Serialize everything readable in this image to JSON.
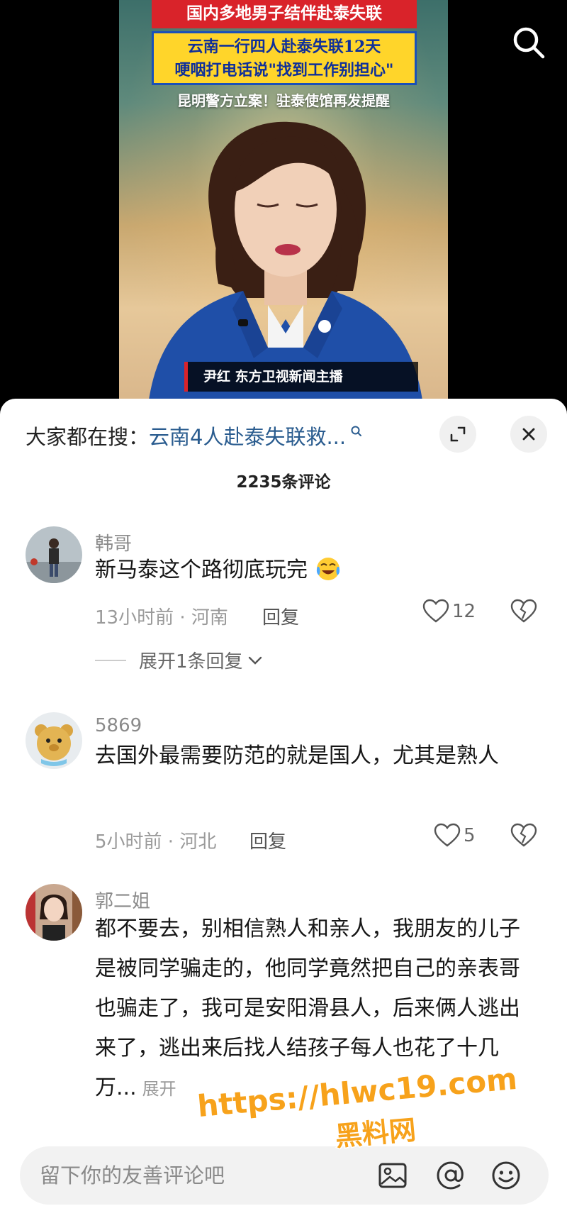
{
  "video": {
    "banner_top": "国内多地男子结伴赴泰失联",
    "banner_line1": "云南一行四人赴泰失联12天",
    "banner_line2": "哽咽打电话说\"找到工作别担心\"",
    "banner_sub": "昆明警方立案！驻泰使馆再发提醒",
    "anchor_caption": "尹红  东方卫视新闻主播"
  },
  "panel": {
    "hot_search_label": "大家都在搜：",
    "hot_search_keyword": "云南4人赴泰失联救...",
    "comment_count": "2235条评论"
  },
  "comments": [
    {
      "user": "韩哥",
      "text": "新马泰这个路彻底玩完",
      "time_location": "13小时前 · 河南",
      "reply_label": "回复",
      "likes": "12",
      "expand_replies": "展开1条回复"
    },
    {
      "user": "5869",
      "text": "去国外最需要防范的就是国人，尤其是熟人",
      "time_location": "5小时前 · 河北",
      "reply_label": "回复",
      "likes": "5"
    },
    {
      "user": "郭二姐",
      "text": "都不要去，别相信熟人和亲人，我朋友的儿子是被同学骗走的，他同学竟然把自己的亲表哥也骗走了，我可是安阳滑县人，后来俩人逃出来了，逃出来后找人结孩子每人也花了十几万...",
      "expand_more": "展开"
    }
  ],
  "input_bar": {
    "placeholder": "留下你的友善评论吧"
  },
  "watermark": {
    "line1": "https://hlwc19.com",
    "line2": "黑料网"
  },
  "colors": {
    "link_blue": "#2a5c8f",
    "banner_red": "#d9232a",
    "banner_yellow": "#ffd52a",
    "watermark_orange": "#f7a21b"
  }
}
